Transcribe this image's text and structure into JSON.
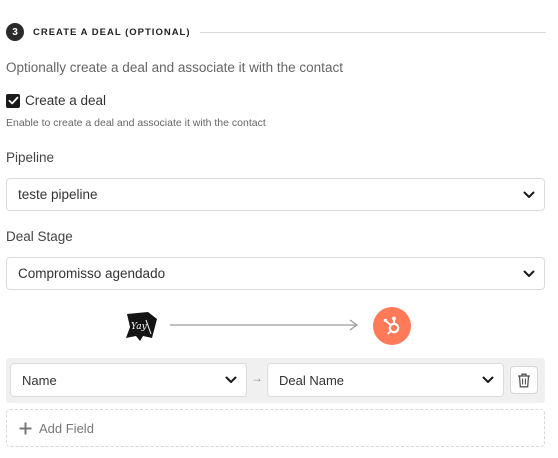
{
  "section": {
    "step_number": "3",
    "title": "CREATE A DEAL (OPTIONAL)",
    "description": "Optionally create a deal and associate it with the contact"
  },
  "create_deal": {
    "label": "Create a deal",
    "checked": true,
    "hint": "Enable to create a deal and associate it with the contact"
  },
  "pipeline": {
    "label": "Pipeline",
    "value": "teste pipeline"
  },
  "deal_stage": {
    "label": "Deal Stage",
    "value": "Compromisso agendado"
  },
  "flow": {
    "source_icon": "yay-forms-logo-icon",
    "target_icon": "hubspot-logo-icon",
    "target_color": "#ff7a59"
  },
  "mapping": {
    "rows": [
      {
        "source": "Name",
        "arrow": "→",
        "target": "Deal Name"
      }
    ]
  },
  "add_field": {
    "label": "Add Field"
  }
}
